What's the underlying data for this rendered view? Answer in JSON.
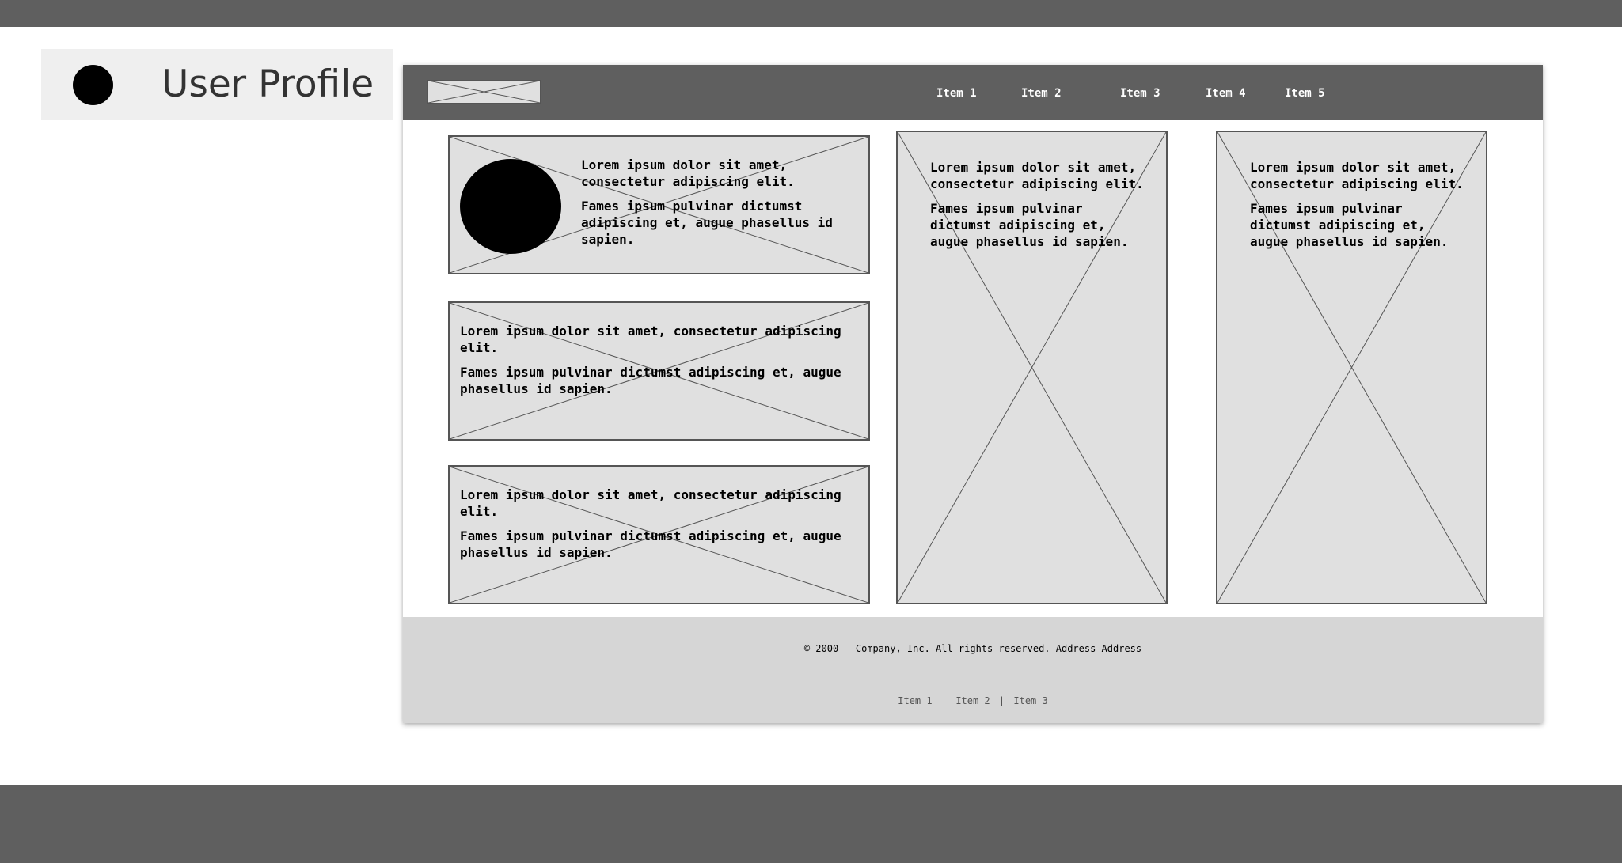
{
  "profile": {
    "title": "User Profile"
  },
  "nav": {
    "items": [
      "Item 1",
      "Item 2",
      "Item 3",
      "Item 4",
      "Item 5"
    ]
  },
  "cards": {
    "card1": {
      "p1": "Lorem ipsum dolor sit amet, consectetur adipiscing elit.",
      "p2": "Fames ipsum pulvinar dictumst adipiscing et, augue phasellus id sapien."
    },
    "card2": {
      "p1": "Lorem ipsum dolor sit amet, consectetur adipiscing elit.",
      "p2": "Fames ipsum pulvinar dictumst adipiscing et, augue phasellus id sapien."
    },
    "card3": {
      "p1": "Lorem ipsum dolor sit amet, consectetur adipiscing elit.",
      "p2": "Fames ipsum pulvinar dictumst adipiscing et, augue phasellus id sapien."
    },
    "tall1": {
      "p1": "Lorem ipsum dolor sit amet, consectetur adipiscing elit.",
      "p2": "Fames ipsum pulvinar dictumst adipiscing et, augue phasellus id sapien."
    },
    "tall2": {
      "p1": "Lorem ipsum dolor sit amet, consectetur adipiscing elit.",
      "p2": "Fames ipsum pulvinar dictumst adipiscing et, augue phasellus id sapien."
    }
  },
  "footer": {
    "copyright": "© 2000 - Company, Inc. All rights reserved. Address Address",
    "links": [
      "Item 1",
      "Item 2",
      "Item 3"
    ],
    "separator": "|"
  },
  "colors": {
    "bar": "#5f5f5f",
    "placeholder": "#e0e0e0",
    "footer": "#d6d6d6",
    "header_bg": "#efefef"
  }
}
